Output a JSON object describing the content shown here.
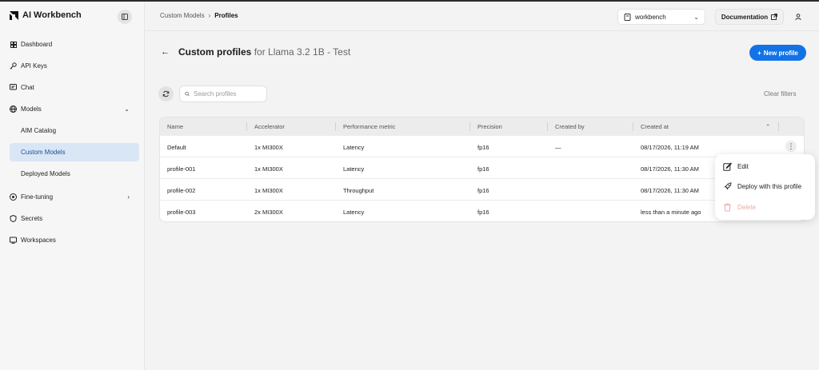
{
  "app": {
    "name": "AI Workbench"
  },
  "sidebar": {
    "items": [
      {
        "label": "Dashboard",
        "icon": "grid-icon"
      },
      {
        "label": "API Keys",
        "icon": "key-icon"
      },
      {
        "label": "Chat",
        "icon": "chat-icon"
      },
      {
        "label": "Models",
        "icon": "globe-icon",
        "expanded": true
      },
      {
        "label": "AIM Catalog"
      },
      {
        "label": "Custom Models",
        "active": true
      },
      {
        "label": "Deployed Models"
      },
      {
        "label": "Fine-tuning",
        "icon": "fine-tuning-icon"
      },
      {
        "label": "Secrets",
        "icon": "shield-icon"
      },
      {
        "label": "Workspaces",
        "icon": "workspace-icon"
      }
    ]
  },
  "topbar": {
    "breadcrumb": [
      "Custom Models",
      "Profiles"
    ],
    "workspace": "workbench",
    "documentation": "Documentation"
  },
  "page": {
    "title": "Custom profiles",
    "subtitle": "for Llama 3.2 1B - Test",
    "new_button": "New profile"
  },
  "toolbar": {
    "search_placeholder": "Search profiles",
    "clear_filters": "Clear filters"
  },
  "table": {
    "columns": [
      "Name",
      "Accelerator",
      "Performance metric",
      "Precision",
      "Created by",
      "Created at"
    ],
    "rows": [
      [
        "Default",
        "1x MI300X",
        "Latency",
        "fp16",
        "—",
        "08/17/2026, 11:19 AM"
      ],
      [
        "profile-001",
        "1x MI300X",
        "Latency",
        "fp16",
        "",
        "08/17/2026, 11:30 AM"
      ],
      [
        "profile-002",
        "1x MI300X",
        "Throughput",
        "fp16",
        "",
        "08/17/2026, 11:30 AM"
      ],
      [
        "profile-003",
        "2x MI300X",
        "Latency",
        "fp16",
        "",
        "less than a minute ago"
      ]
    ]
  },
  "context_menu": {
    "items": [
      "Edit",
      "Deploy with this profile",
      "Delete"
    ]
  },
  "colors": {
    "primary": "#1373e6",
    "active_nav_bg": "#d9e6f6",
    "danger_disabled": "#f1a8a8"
  }
}
